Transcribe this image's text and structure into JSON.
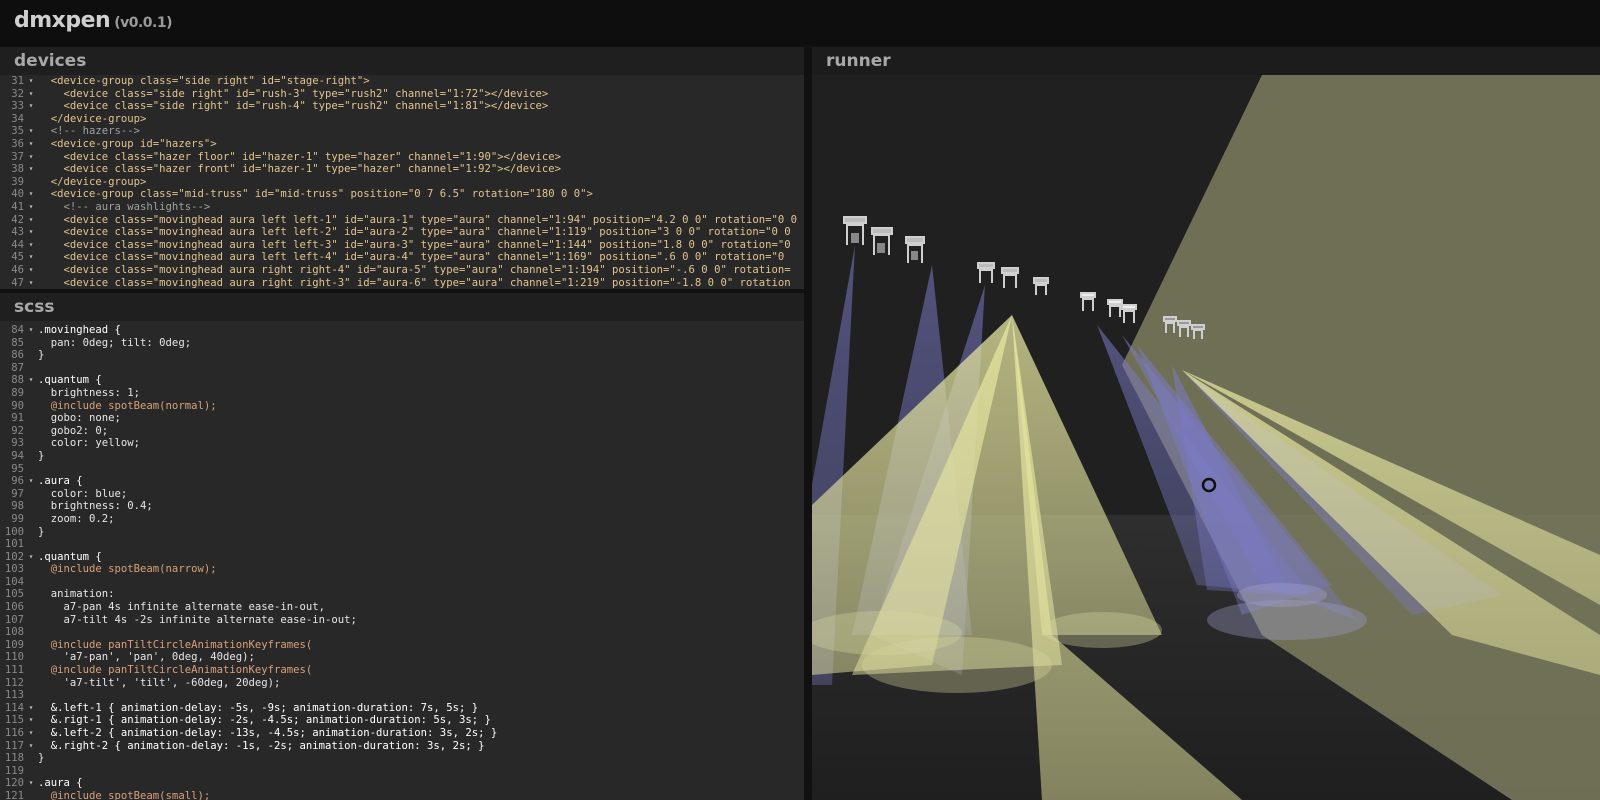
{
  "app": {
    "name": "dmxpen",
    "version": "(v0.0.1)"
  },
  "panels": {
    "devices": "devices",
    "scss": "scss",
    "runner": "runner"
  },
  "devices_lines": [
    {
      "n": "31",
      "f": true,
      "t": "  <device-group class=\"side right\" id=\"stage-right\">"
    },
    {
      "n": "32",
      "f": true,
      "t": "    <device class=\"side right\" id=\"rush-3\" type=\"rush2\" channel=\"1:72\"></device>"
    },
    {
      "n": "33",
      "f": true,
      "t": "    <device class=\"side right\" id=\"rush-4\" type=\"rush2\" channel=\"1:81\"></device>"
    },
    {
      "n": "34",
      "f": false,
      "t": "  </device-group>"
    },
    {
      "n": "35",
      "f": true,
      "t": "  <!-- hazers-->"
    },
    {
      "n": "36",
      "f": true,
      "t": "  <device-group id=\"hazers\">"
    },
    {
      "n": "37",
      "f": true,
      "t": "    <device class=\"hazer floor\" id=\"hazer-1\" type=\"hazer\" channel=\"1:90\"></device>"
    },
    {
      "n": "38",
      "f": true,
      "t": "    <device class=\"hazer front\" id=\"hazer-1\" type=\"hazer\" channel=\"1:92\"></device>"
    },
    {
      "n": "39",
      "f": false,
      "t": "  </device-group>"
    },
    {
      "n": "40",
      "f": true,
      "t": "  <device-group class=\"mid-truss\" id=\"mid-truss\" position=\"0 7 6.5\" rotation=\"180 0 0\">"
    },
    {
      "n": "41",
      "f": true,
      "t": "    <!-- aura washlights-->"
    },
    {
      "n": "42",
      "f": true,
      "t": "    <device class=\"movinghead aura left left-1\" id=\"aura-1\" type=\"aura\" channel=\"1:94\" position=\"4.2 0 0\" rotation=\"0 0"
    },
    {
      "n": "43",
      "f": true,
      "t": "    <device class=\"movinghead aura left left-2\" id=\"aura-2\" type=\"aura\" channel=\"1:119\" position=\"3 0 0\" rotation=\"0 0"
    },
    {
      "n": "44",
      "f": true,
      "t": "    <device class=\"movinghead aura left left-3\" id=\"aura-3\" type=\"aura\" channel=\"1:144\" position=\"1.8 0 0\" rotation=\"0"
    },
    {
      "n": "45",
      "f": true,
      "t": "    <device class=\"movinghead aura left left-4\" id=\"aura-4\" type=\"aura\" channel=\"1:169\" position=\".6 0 0\" rotation=\"0"
    },
    {
      "n": "46",
      "f": true,
      "t": "    <device class=\"movinghead aura right right-4\" id=\"aura-5\" type=\"aura\" channel=\"1:194\" position=\"-.6 0 0\" rotation="
    },
    {
      "n": "47",
      "f": true,
      "t": "    <device class=\"movinghead aura right right-3\" id=\"aura-6\" type=\"aura\" channel=\"1:219\" position=\"-1.8 0 0\" rotation"
    }
  ],
  "scss_lines": [
    {
      "n": "84",
      "f": true,
      "t": ".movinghead {"
    },
    {
      "n": "85",
      "f": false,
      "t": "  pan: 0deg; tilt: 0deg;"
    },
    {
      "n": "86",
      "f": false,
      "t": "}"
    },
    {
      "n": "87",
      "f": false,
      "t": ""
    },
    {
      "n": "88",
      "f": true,
      "t": ".quantum {"
    },
    {
      "n": "89",
      "f": false,
      "t": "  brightness: 1;"
    },
    {
      "n": "90",
      "f": false,
      "t": "  @include spotBeam(normal);"
    },
    {
      "n": "91",
      "f": false,
      "t": "  gobo: none;"
    },
    {
      "n": "92",
      "f": false,
      "t": "  gobo2: 0;"
    },
    {
      "n": "93",
      "f": false,
      "t": "  color: yellow;"
    },
    {
      "n": "94",
      "f": false,
      "t": "}"
    },
    {
      "n": "95",
      "f": false,
      "t": ""
    },
    {
      "n": "96",
      "f": true,
      "t": ".aura {"
    },
    {
      "n": "97",
      "f": false,
      "t": "  color: blue;"
    },
    {
      "n": "98",
      "f": false,
      "t": "  brightness: 0.4;"
    },
    {
      "n": "99",
      "f": false,
      "t": "  zoom: 0.2;"
    },
    {
      "n": "100",
      "f": false,
      "t": "}"
    },
    {
      "n": "101",
      "f": false,
      "t": ""
    },
    {
      "n": "102",
      "f": true,
      "t": ".quantum {"
    },
    {
      "n": "103",
      "f": false,
      "t": "  @include spotBeam(narrow);"
    },
    {
      "n": "104",
      "f": false,
      "t": ""
    },
    {
      "n": "105",
      "f": false,
      "t": "  animation:"
    },
    {
      "n": "106",
      "f": false,
      "t": "    a7-pan 4s infinite alternate ease-in-out,"
    },
    {
      "n": "107",
      "f": false,
      "t": "    a7-tilt 4s -2s infinite alternate ease-in-out;"
    },
    {
      "n": "108",
      "f": false,
      "t": ""
    },
    {
      "n": "109",
      "f": false,
      "t": "  @include panTiltCircleAnimationKeyframes("
    },
    {
      "n": "110",
      "f": false,
      "t": "    'a7-pan', 'pan', 0deg, 40deg);"
    },
    {
      "n": "111",
      "f": false,
      "t": "  @include panTiltCircleAnimationKeyframes("
    },
    {
      "n": "112",
      "f": false,
      "t": "    'a7-tilt', 'tilt', -60deg, 20deg);"
    },
    {
      "n": "113",
      "f": false,
      "t": ""
    },
    {
      "n": "114",
      "f": true,
      "t": "  &.left-1 { animation-delay: -5s, -9s; animation-duration: 7s, 5s; }"
    },
    {
      "n": "115",
      "f": true,
      "t": "  &.rigt-1 { animation-delay: -2s, -4.5s; animation-duration: 5s, 3s; }"
    },
    {
      "n": "116",
      "f": true,
      "t": "  &.left-2 { animation-delay: -13s, -4.5s; animation-duration: 3s, 2s; }"
    },
    {
      "n": "117",
      "f": true,
      "t": "  &.right-2 { animation-delay: -1s, -2s; animation-duration: 3s, 2s; }"
    },
    {
      "n": "118",
      "f": false,
      "t": "}"
    },
    {
      "n": "119",
      "f": false,
      "t": ""
    },
    {
      "n": "120",
      "f": true,
      "t": ".aura {"
    },
    {
      "n": "121",
      "f": false,
      "t": "  @include spotBeam(small);"
    }
  ],
  "colors": {
    "beam_yellow": "#e6e6a0",
    "beam_blue": "#7a7ac8",
    "background": "#202020"
  },
  "icons": {
    "fold_marker": "fold-arrow-icon",
    "fixture": "moving-head-fixture-icon",
    "cursor": "cursor-circle-icon"
  }
}
